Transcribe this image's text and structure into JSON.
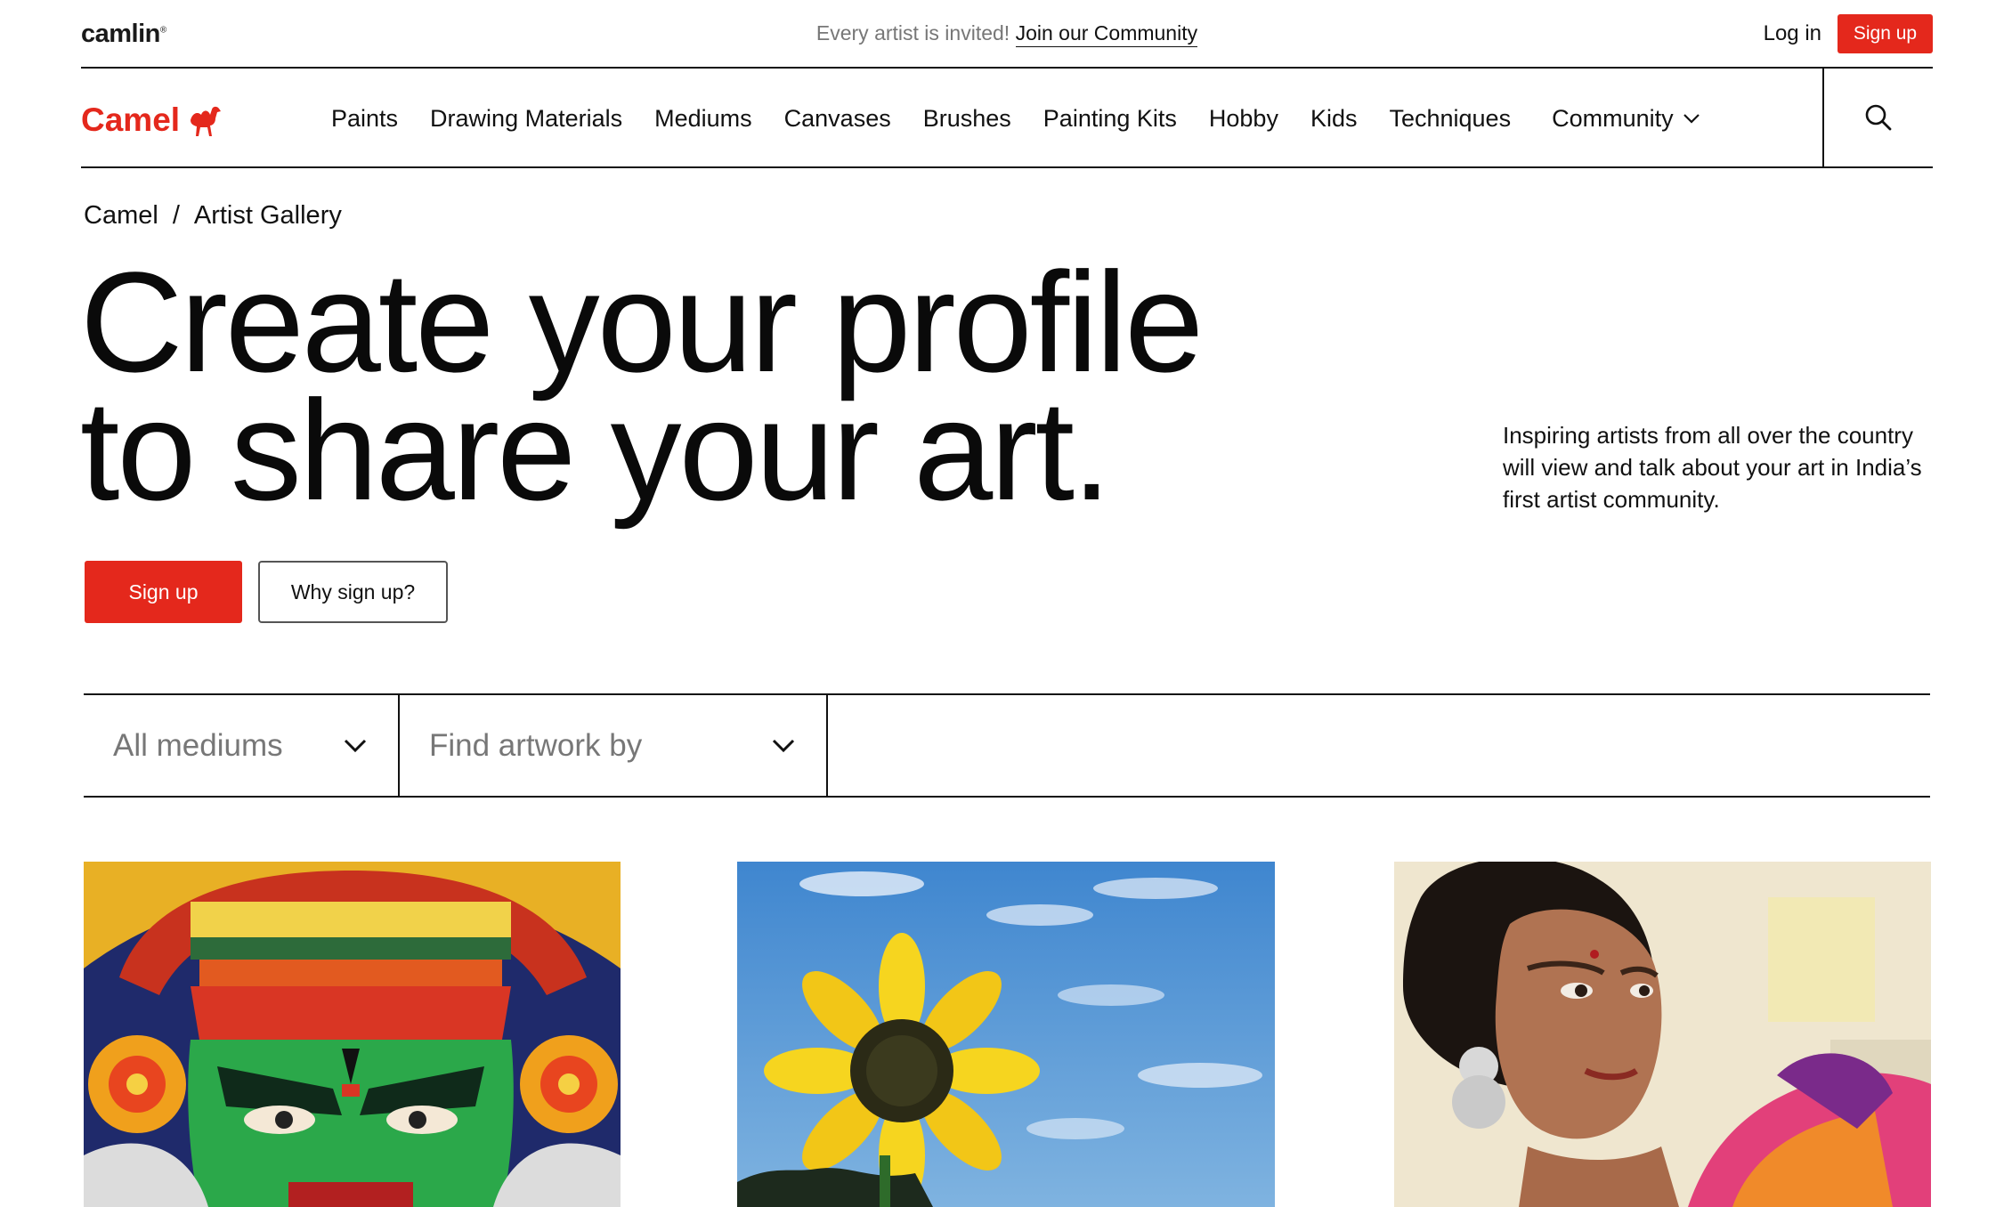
{
  "topbar": {
    "brand": "camlin",
    "promo_text": "Every artist is invited!",
    "promo_link": "Join our Community",
    "login_label": "Log in",
    "signup_label": "Sign up"
  },
  "nav": {
    "logo_text": "Camel",
    "items": [
      {
        "label": "Paints"
      },
      {
        "label": "Drawing Materials"
      },
      {
        "label": "Mediums"
      },
      {
        "label": "Canvases"
      },
      {
        "label": "Brushes"
      },
      {
        "label": "Painting Kits"
      },
      {
        "label": "Hobby"
      },
      {
        "label": "Kids"
      },
      {
        "label": "Techniques"
      }
    ],
    "community_label": "Community"
  },
  "breadcrumb": {
    "items": [
      "Camel",
      "Artist Gallery"
    ],
    "separator": "/"
  },
  "hero": {
    "title_line1": "Create your profile",
    "title_line2": "to share your art.",
    "description": "Inspiring artists from all over the country will view and talk about your art in India’s first artist community.",
    "primary_button": "Sign up",
    "secondary_button": "Why sign up?"
  },
  "filters": {
    "medium_select": "All mediums",
    "find_by_select": "Find artwork by"
  },
  "gallery": {
    "artworks": [
      {
        "subject": "kathakali-face-painting"
      },
      {
        "subject": "sunflower-sky-painting"
      },
      {
        "subject": "woman-portrait-painting"
      }
    ]
  },
  "colors": {
    "accent": "#e4281c",
    "text": "#111111",
    "muted": "#777777"
  }
}
